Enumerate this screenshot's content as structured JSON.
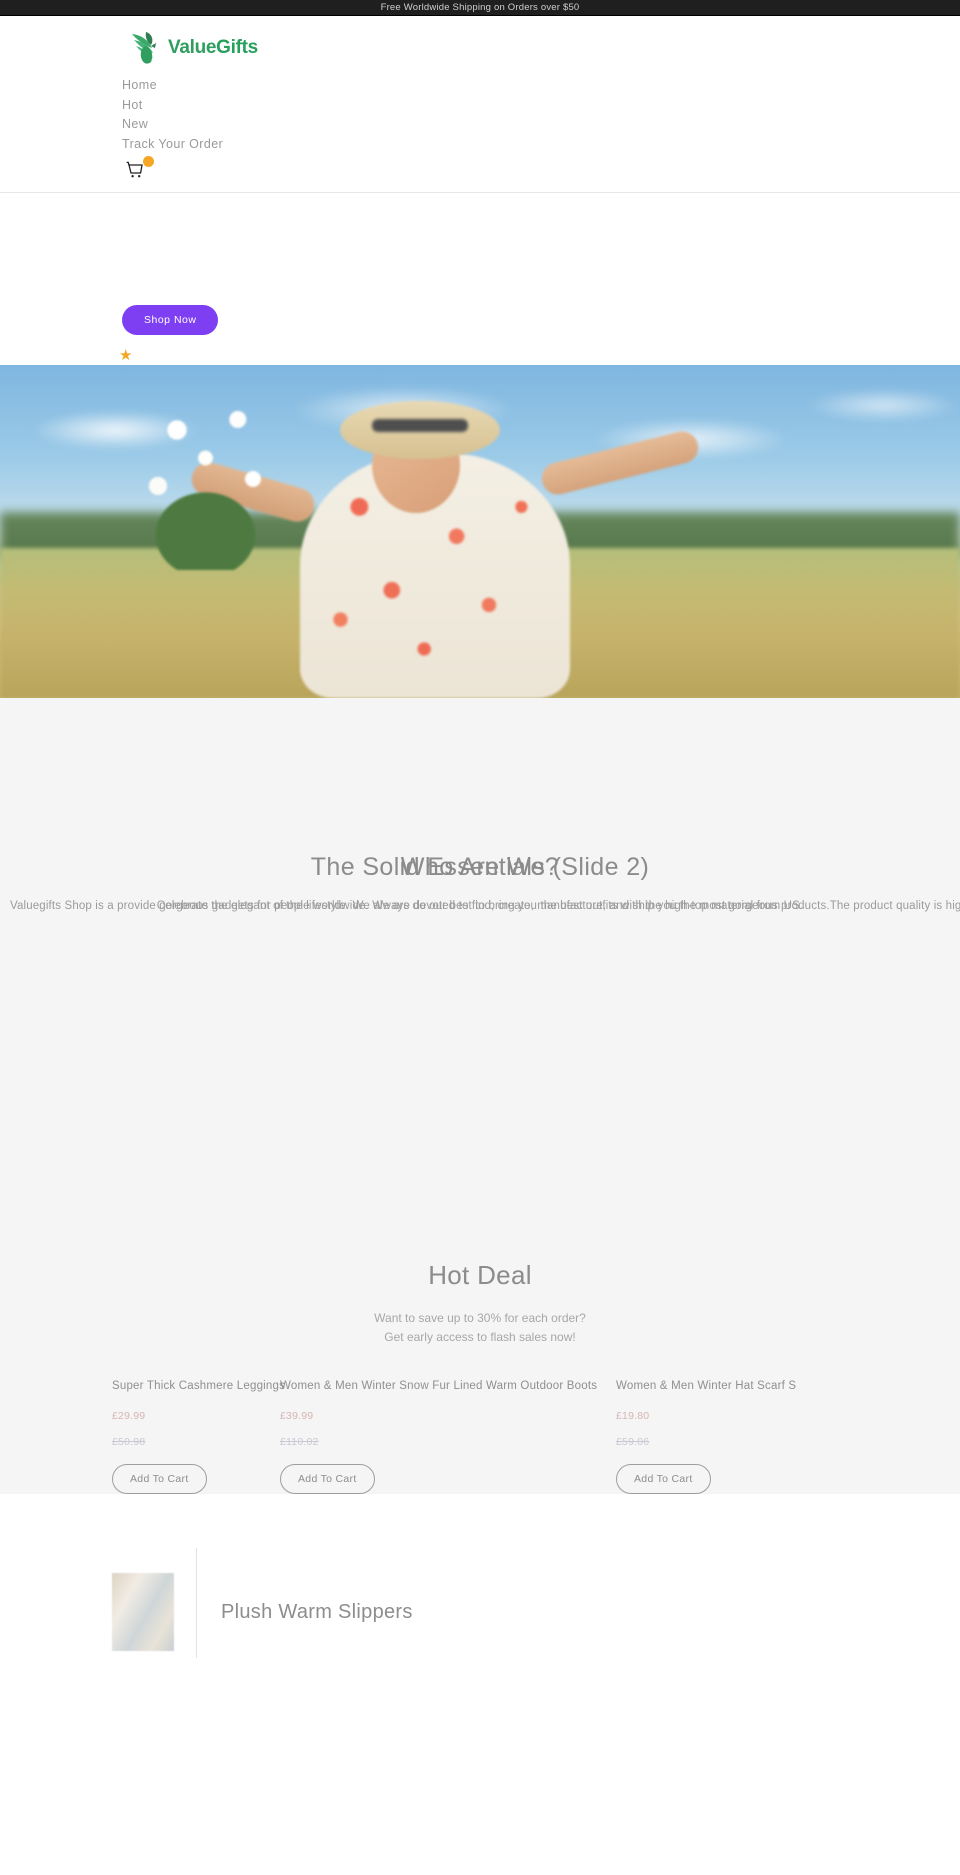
{
  "announcement": {
    "text": "Free Worldwide Shipping on Orders over $50"
  },
  "header": {
    "logo": {
      "text_primary": "Value",
      "text_secondary": "Gifts",
      "icon": "hummingbird-leaf-logo-icon",
      "color": "#2f9e5f"
    },
    "nav": [
      {
        "label": "Home"
      },
      {
        "label": "Hot"
      },
      {
        "label": "New"
      },
      {
        "label": "Track Your Order"
      }
    ],
    "cart": {
      "icon": "shopping-cart-icon",
      "badge_color": "#f5a623"
    }
  },
  "hero": {
    "cta_label": "Shop Now",
    "cta_color": "#7e3ff2",
    "star_icon": "star-icon",
    "slide_image_alt": "woman in floral dress holding daisies in a field"
  },
  "about": {
    "slide_1": {
      "heading": "Who Are We?",
      "paragraph": "Valuegifts Shop is a provide gorgeous gadgets for people worldwide. We are devoted to find, create, manufacture, and ship you the most gorgeous products.The product quality is highly guaranteed."
    },
    "slide_2": {
      "heading": "The Solid Essentials (Slide 2)",
      "paragraph": "Celebrate the elegant of the lifestyle. We always do our best to bring you the best outfits with the high-top material from US."
    }
  },
  "hot_deal": {
    "title": "Hot Deal",
    "subtitle_line_1": "Want to save up to 30% for each order?",
    "subtitle_line_2": "Get early access to flash sales now!",
    "products": [
      {
        "title": "Super Thick Cashmere Leggings",
        "price": "£29.99",
        "compare_at": "£50.98",
        "add_to_cart_label": "Add To Cart"
      },
      {
        "title": "Women & Men Winter Snow Fur Lined Warm Outdoor Boots",
        "price": "£39.99",
        "compare_at": "£110.02",
        "add_to_cart_label": "Add To Cart"
      },
      {
        "title": "Women & Men Winter Hat Scarf S",
        "price": "£19.80",
        "compare_at": "£59.06",
        "add_to_cart_label": "Add To Cart"
      }
    ]
  },
  "featured": {
    "title": "Plush Warm Slippers",
    "thumbnail_alt": "plush warm slippers product thumbnail"
  }
}
